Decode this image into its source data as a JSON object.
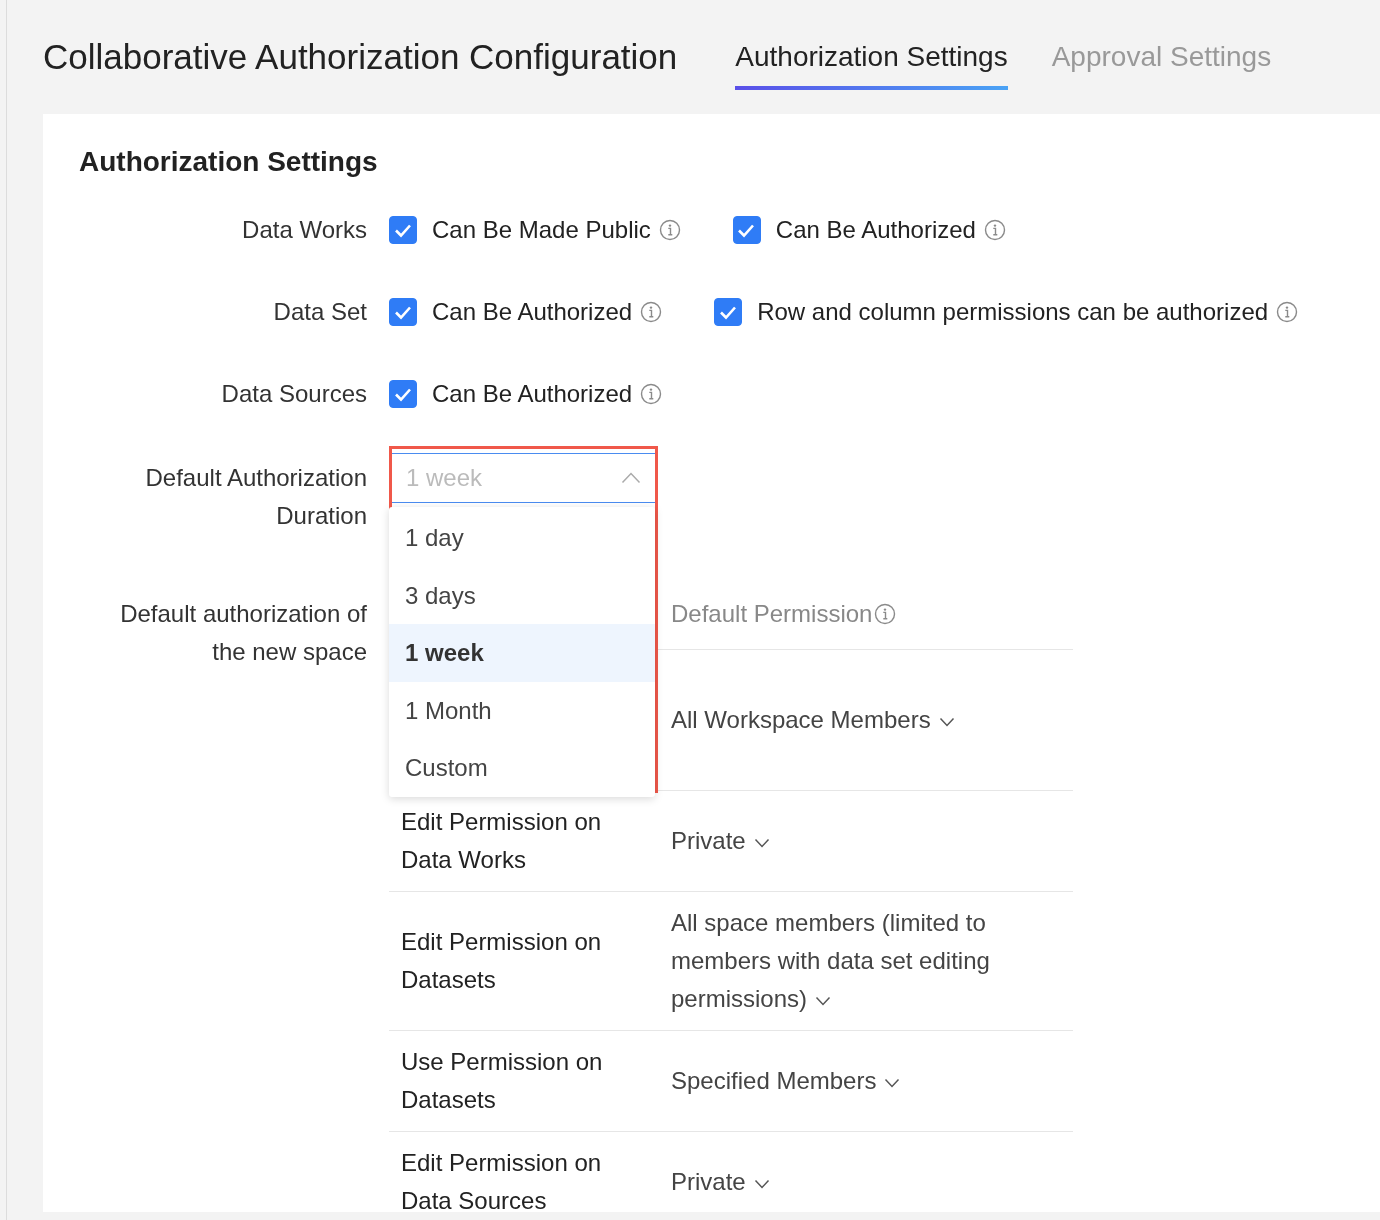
{
  "header": {
    "title": "Collaborative Authorization Configuration",
    "tabs": [
      {
        "label": "Authorization Settings",
        "selected": true
      },
      {
        "label": "Approval Settings",
        "selected": false
      }
    ]
  },
  "section_title": "Authorization Settings",
  "settings": [
    {
      "label": "Data Works",
      "options": [
        {
          "label": "Can Be Made Public",
          "checked": true
        },
        {
          "label": "Can Be Authorized",
          "checked": true
        }
      ]
    },
    {
      "label": "Data Set",
      "options": [
        {
          "label": "Can Be Authorized",
          "checked": true
        },
        {
          "label": "Row and column permissions can be authorized",
          "checked": true
        }
      ]
    },
    {
      "label": "Data Sources",
      "options": [
        {
          "label": "Can Be Authorized",
          "checked": true
        }
      ]
    }
  ],
  "duration": {
    "label": "Default Authorization Duration",
    "value": "1 week",
    "expanded": true,
    "options": [
      {
        "label": "1 day",
        "selected": false
      },
      {
        "label": "3 days",
        "selected": false
      },
      {
        "label": "1 week",
        "selected": true
      },
      {
        "label": "1 Month",
        "selected": false
      },
      {
        "label": "Custom",
        "selected": false
      }
    ]
  },
  "new_space": {
    "label": "Default authorization of the new space",
    "permission_header": "Default Permission",
    "rows": [
      {
        "permission": "All Workspace Members"
      },
      {
        "item": "Edit Permission on Data Works",
        "permission": "Private"
      },
      {
        "item": "Edit Permission on Datasets",
        "permission": "All space members (limited to members with data set editing permissions)"
      },
      {
        "item": "Use Permission on Datasets",
        "permission": "Specified Members"
      },
      {
        "item": "Edit Permission on Data Sources",
        "permission": "Private"
      }
    ]
  }
}
